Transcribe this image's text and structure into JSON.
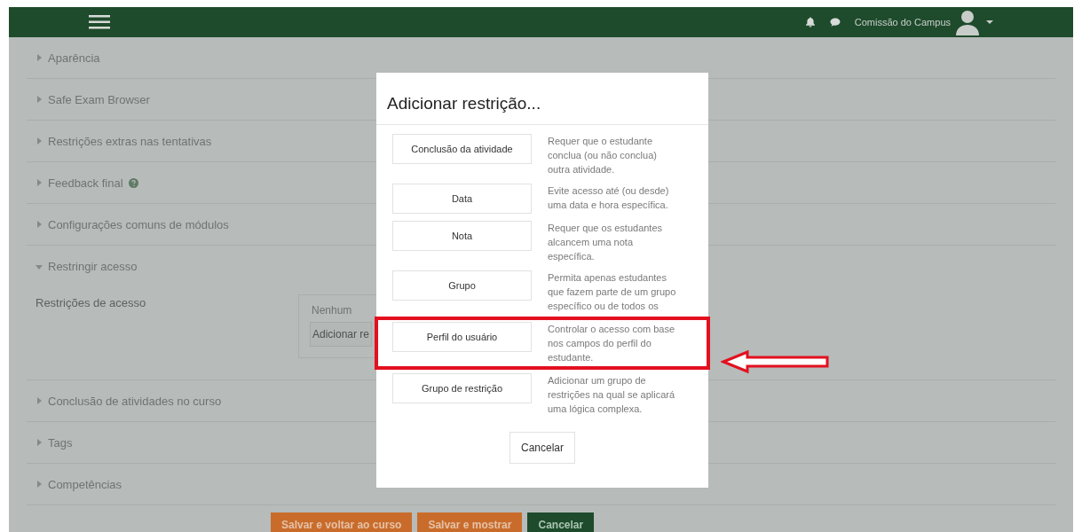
{
  "navbar": {
    "user_name": "Comissão do Campus"
  },
  "sections": [
    {
      "title": "Aparência",
      "expanded": false
    },
    {
      "title": "Safe Exam Browser",
      "expanded": false
    },
    {
      "title": "Restrições extras nas tentativas",
      "expanded": false
    },
    {
      "title": "Feedback final",
      "expanded": false,
      "help": true
    },
    {
      "title": "Configurações comuns de módulos",
      "expanded": false
    },
    {
      "title": "Restringir acesso",
      "expanded": true,
      "field_label": "Restrições de acesso",
      "restrictions_text": "Nenhum",
      "add_button": "Adicionar re"
    },
    {
      "title": "Conclusão de atividades no curso",
      "expanded": false
    },
    {
      "title": "Tags",
      "expanded": false
    },
    {
      "title": "Competências",
      "expanded": false
    }
  ],
  "footer_buttons": [
    {
      "label": "Salvar e voltar ao curso",
      "kind": "primary"
    },
    {
      "label": "Salvar e mostrar",
      "kind": "primary"
    },
    {
      "label": "Cancelar",
      "kind": "secondary"
    }
  ],
  "dialog": {
    "title": "Adicionar restrição...",
    "options": [
      {
        "button": "Conclusão da atividade",
        "description": "Requer que o estudante conclua (ou não conclua) outra atividade.",
        "highlighted": false
      },
      {
        "button": "Data",
        "description": "Evite acesso até (ou desde) uma data e hora específica.",
        "highlighted": false
      },
      {
        "button": "Nota",
        "description": "Requer que os estudantes alcancem uma nota específica.",
        "highlighted": false
      },
      {
        "button": "Grupo",
        "description": "Permita apenas estudantes que fazem parte de um grupo específico ou de todos os",
        "highlighted": false
      },
      {
        "button": "Perfil do usuário",
        "description": "Controlar o acesso com base nos campos do perfil do estudante.",
        "highlighted": true
      },
      {
        "button": "Grupo de restrição",
        "description": "Adicionar um grupo de restrições na qual se aplicará uma lógica complexa.",
        "highlighted": false
      }
    ],
    "cancel": "Cancelar"
  }
}
